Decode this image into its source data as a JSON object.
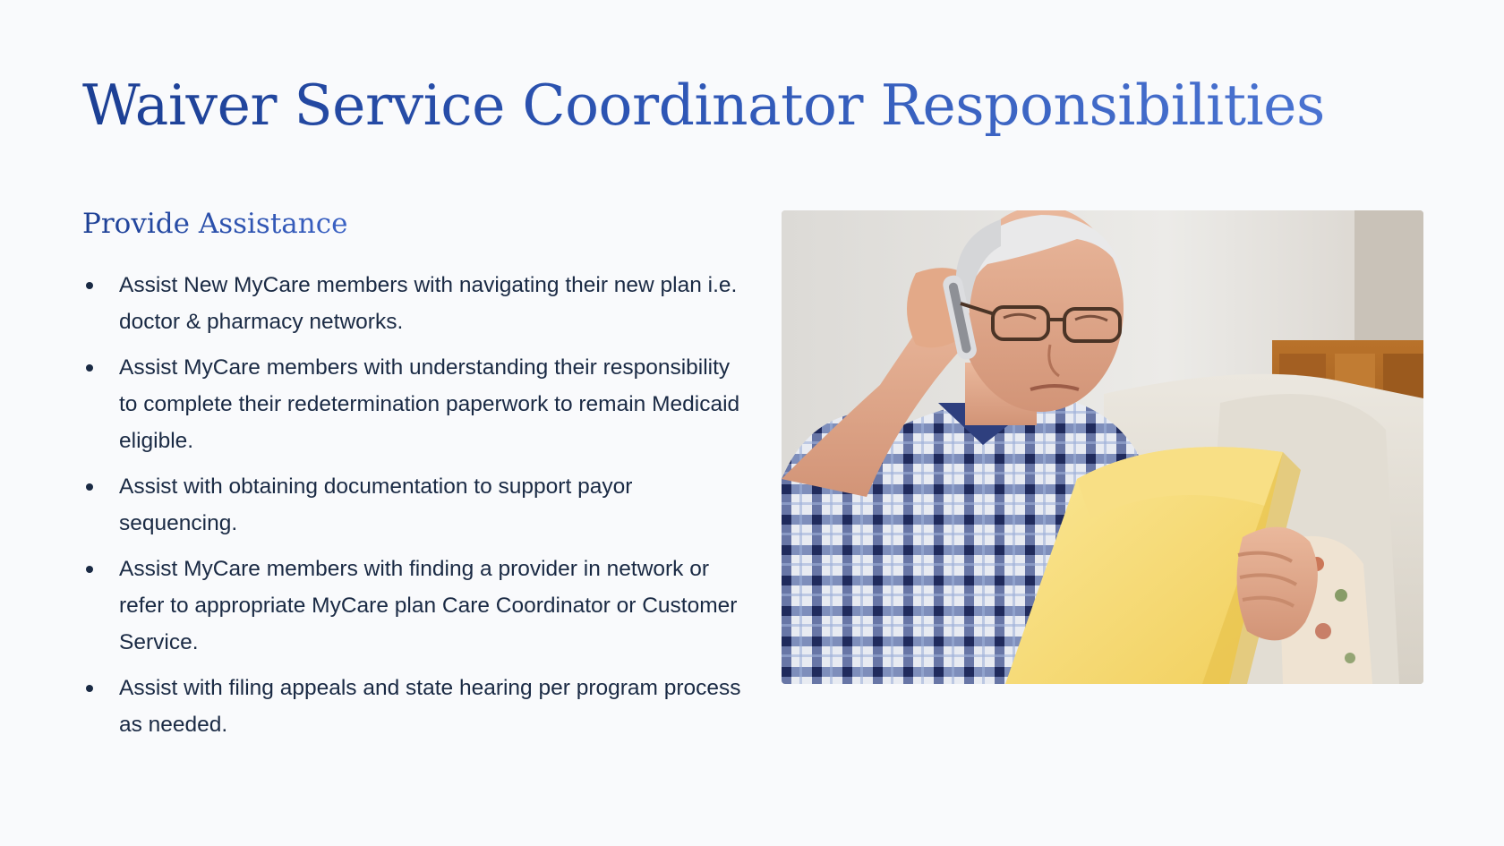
{
  "slide": {
    "title": "Waiver Service Coordinator Responsibilities",
    "section_heading": "Provide Assistance",
    "bullets": [
      "Assist New MyCare members with navigating their new plan i.e. doctor & pharmacy networks.",
      "Assist MyCare members with understanding their responsibility to complete their redetermination paperwork to remain Medicaid eligible.",
      "Assist with obtaining documentation to support payor sequencing.",
      "Assist MyCare members with finding a provider in network or refer to appropriate MyCare plan Care Coordinator or Customer Service.",
      "Assist with filing appeals and state hearing per program process as needed."
    ]
  },
  "photo": {
    "subject": "older-man-on-phone-reading-papers"
  },
  "colors": {
    "background": "#f9fafc",
    "title_dark": "#1c3f94",
    "title_light": "#4a73d1",
    "body_text": "#1a2a44"
  }
}
